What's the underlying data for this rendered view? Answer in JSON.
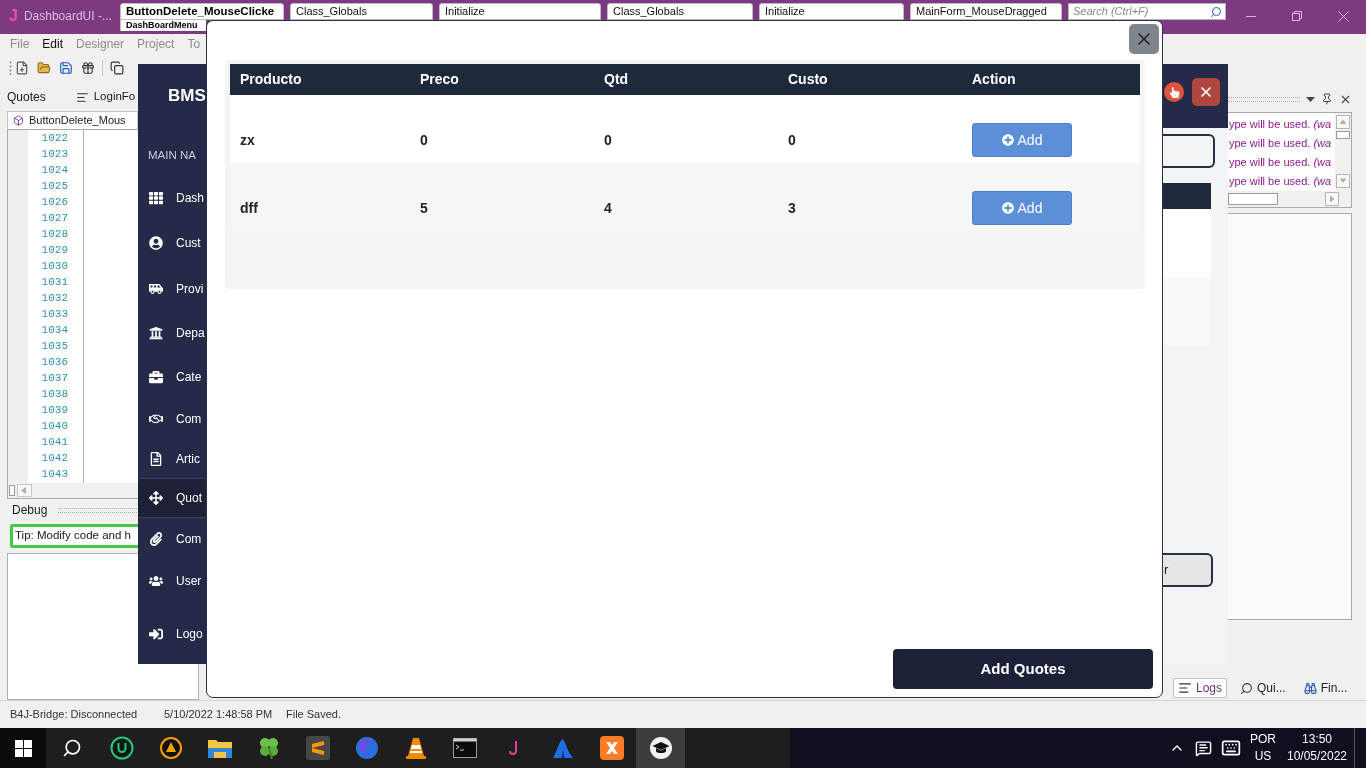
{
  "ide": {
    "logo": "J",
    "title": "DashboardUI -...",
    "tabs": [
      {
        "label": "ButtonDelete_MouseClicke",
        "sublabel": "DashBoardMenu",
        "selected": true
      },
      {
        "label": "Class_Globals",
        "selected": false
      },
      {
        "label": "Initialize",
        "selected": false
      },
      {
        "label": "Class_Globals",
        "selected": false
      },
      {
        "label": "Initialize",
        "selected": false
      },
      {
        "label": "MainForm_MouseDragged",
        "selected": false
      }
    ],
    "search": {
      "placeholder": "Search (Ctrl+F)"
    },
    "menu": [
      {
        "label": "File",
        "disabled": true
      },
      {
        "label": "Edit",
        "disabled": false
      },
      {
        "label": "Designer",
        "disabled": true
      },
      {
        "label": "Project",
        "disabled": true
      },
      {
        "label": "To",
        "disabled": true
      }
    ],
    "panel_tabs": [
      {
        "label": "Quotes",
        "kind": "label"
      },
      {
        "label": "LoginFo",
        "kind": "tab"
      }
    ],
    "code_tab": "ButtonDelete_Mous",
    "line_numbers": [
      "1022",
      "1023",
      "1024",
      "1025",
      "1026",
      "1027",
      "1028",
      "1029",
      "1030",
      "1031",
      "1032",
      "1033",
      "1034",
      "1035",
      "1036",
      "1037",
      "1038",
      "1039",
      "1040",
      "1041",
      "1042",
      "1043"
    ],
    "debug": {
      "title": "Debug",
      "tip": "Tip: Modify code and h"
    },
    "log_lines": [
      "ype will be used. *(wa*",
      "ype will be used. *(wa*",
      "ype will be used. *(wa*",
      "ype will be used. *(wa*"
    ],
    "bottom_tabs": [
      {
        "label": "Logs",
        "selected": true
      },
      {
        "label": "Qui...",
        "selected": false
      },
      {
        "label": "Fin...",
        "selected": false
      }
    ],
    "status_bar": [
      "B4J-Bridge: Disconnected",
      "5/10/2022 1:48:58 PM",
      "File Saved."
    ]
  },
  "app_window": {
    "brand": "BMS",
    "section": "MAIN NA",
    "nav": [
      {
        "label": "Dash",
        "selected": false
      },
      {
        "label": "Cust",
        "selected": false
      },
      {
        "label": "Provi",
        "selected": false
      },
      {
        "label": "Depa",
        "selected": false
      },
      {
        "label": "Cate",
        "selected": false
      },
      {
        "label": "Com",
        "selected": false
      },
      {
        "label": "Artic",
        "selected": false
      },
      {
        "label": "Quot",
        "selected": true
      },
      {
        "label": "Com",
        "selected": false
      },
      {
        "label": "User",
        "selected": false
      },
      {
        "label": "Logo",
        "selected": false
      }
    ],
    "button": "r"
  },
  "modal": {
    "columns": [
      "Producto",
      "Preco",
      "Qtd",
      "Custo",
      "Action"
    ],
    "rows": [
      {
        "cells": [
          "zx",
          "0",
          "0",
          "0"
        ],
        "action": "Add"
      },
      {
        "cells": [
          "dff",
          "5",
          "4",
          "3"
        ],
        "action": "Add"
      }
    ],
    "submit": "Add Quotes"
  },
  "taskbar": {
    "apps": [
      {
        "selected": false
      },
      {
        "selected": false
      },
      {
        "selected": false
      },
      {
        "selected": false
      },
      {
        "selected": false
      },
      {
        "selected": false
      },
      {
        "selected": false
      },
      {
        "selected": false
      },
      {
        "selected": false
      },
      {
        "selected": false
      },
      {
        "selected": false
      },
      {
        "selected": true
      }
    ],
    "tray": {
      "language": "POR",
      "layout": "US",
      "time": "13:50",
      "date": "10/05/2022"
    }
  }
}
